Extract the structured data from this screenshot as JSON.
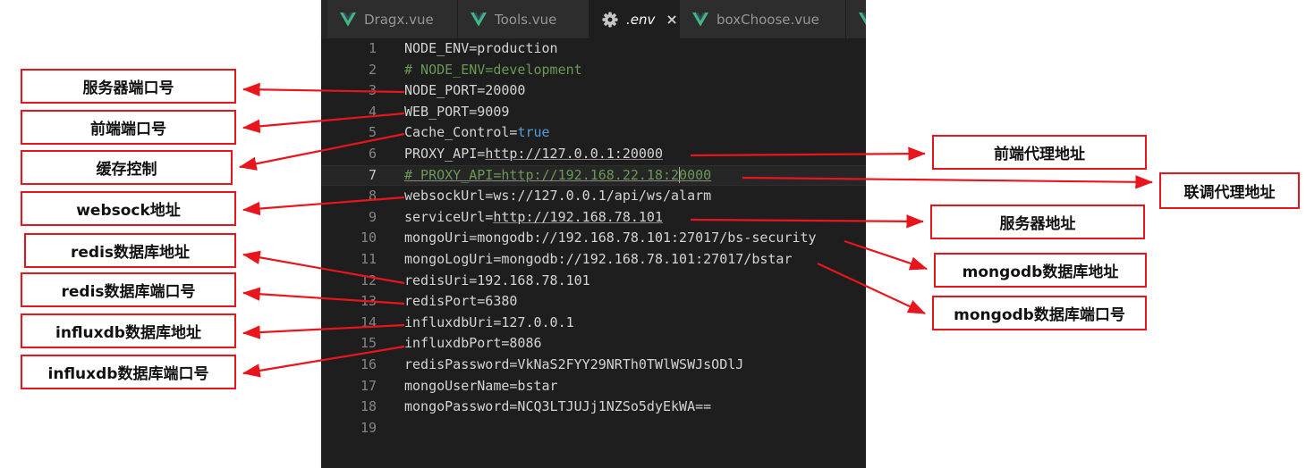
{
  "tabs": [
    {
      "label": "Dragx.vue",
      "icon": "vue-icon",
      "active": false
    },
    {
      "label": "Tools.vue",
      "icon": "vue-icon",
      "active": false
    },
    {
      "label": ".env",
      "icon": "gear-icon",
      "active": true
    },
    {
      "label": "boxChoose.vue",
      "icon": "vue-icon",
      "active": false
    }
  ],
  "tab_close_glyph": "×",
  "code_lines": [
    {
      "n": "1",
      "text": "NODE_ENV=production"
    },
    {
      "n": "2",
      "text": "# NODE_ENV=development",
      "comment": true
    },
    {
      "n": "3",
      "text": "NODE_PORT=20000"
    },
    {
      "n": "4",
      "text": "WEB_PORT=9009"
    },
    {
      "n": "5",
      "key": "Cache_Control=",
      "kw": "true"
    },
    {
      "n": "6",
      "key": "PROXY_API=",
      "url": "http://127.0.0.1:20000"
    },
    {
      "n": "7",
      "pre": "# PROXY_API=http://192.168.22.18:2",
      "post": "0000",
      "comment": true,
      "current": true
    },
    {
      "n": "8",
      "text": "websockUrl=ws://127.0.0.1/api/ws/alarm"
    },
    {
      "n": "9",
      "key": "serviceUrl=",
      "url": "http://192.168.78.101"
    },
    {
      "n": "10",
      "text": "mongoUri=mongodb://192.168.78.101:27017/bs-security"
    },
    {
      "n": "11",
      "text": "mongoLogUri=mongodb://192.168.78.101:27017/bstar"
    },
    {
      "n": "12",
      "text": "redisUri=192.168.78.101"
    },
    {
      "n": "13",
      "text": "redisPort=6380"
    },
    {
      "n": "14",
      "text": "influxdbUri=127.0.0.1"
    },
    {
      "n": "15",
      "text": "influxdbPort=8086"
    },
    {
      "n": "16",
      "text": "redisPassword=VkNaS2FYY29NRTh0TWlWSWJsODlJ"
    },
    {
      "n": "17",
      "text": "mongoUserName=bstar"
    },
    {
      "n": "18",
      "text": "mongoPassword=NCQ3LTJUJj1NZSo5dyEkWA=="
    },
    {
      "n": "19",
      "text": ""
    }
  ],
  "annotations": {
    "left": [
      "服务器端口号",
      "前端端口号",
      "缓存控制",
      "websock地址",
      "redis数据库地址",
      "redis数据库端口号",
      "influxdb数据库地址",
      "influxdb数据库端口号"
    ],
    "right": [
      "前端代理地址",
      "联调代理地址",
      "服务器地址",
      "mongodb数据库地址",
      "mongodb数据库端口号"
    ]
  },
  "colors": {
    "editor_bg": "#1e1e1e",
    "tabbar_bg": "#252526",
    "comment": "#6a9955",
    "keyword": "#569cd6",
    "vue_green": "#41b883",
    "annotation_red": "#e8161c"
  }
}
